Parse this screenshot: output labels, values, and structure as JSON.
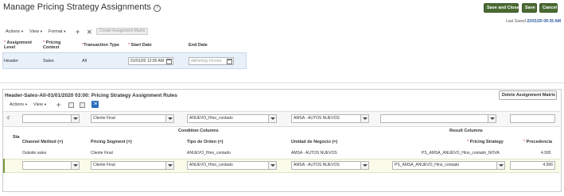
{
  "header": {
    "title": "Manage Pricing Strategy Assignments",
    "save_and_close": "Save and Close",
    "save": "Save",
    "cancel": "Cancel",
    "last_saved_label": "Last Saved",
    "last_saved_value": "22/01/20 09:35 AM"
  },
  "toolbar": {
    "actions": "Actions",
    "view": "View",
    "format": "Format",
    "create_matrix": "Create Assignment Matrix"
  },
  "top_table": {
    "headers": {
      "assignment_level": "Assignment Level",
      "pricing_context": "Pricing Context",
      "transaction_type": "Transaction Type",
      "start_date": "Start Date",
      "end_date": "End Date"
    },
    "row": {
      "assignment_level": "Header",
      "pricing_context": "Sales",
      "transaction_type": "All",
      "start_date": "01/01/20 12:00 AM",
      "end_date_placeholder": "dd/mm/yy hh:mm"
    }
  },
  "rules": {
    "title": "Header-Sales-All-01/01/2020 03:00: Pricing Strategy Assignment Rules",
    "delete_matrix": "Delete Assignment Matrix",
    "actions": "Actions",
    "view": "View",
    "filter": {
      "pricing_segment": "Cliente Final",
      "tipo_orden": "ANUEVO_Hino_contado",
      "unidad_negocio": "AMSA - AUTOS NUEVOS"
    },
    "status_col": "Sta",
    "condition_columns": "Condition Columns",
    "result_columns": "Result Columns",
    "columns": {
      "channel_method": "Channel Method (=)",
      "pricing_segment": "Pricing Segment (=)",
      "tipo_orden": "Tipo de Orden (=)",
      "unidad_negocio": "Unidad de Negocio (=)",
      "pricing_strategy": "Pricing Strategy",
      "precedencia": "Precedencia"
    },
    "rows": [
      {
        "channel_method": "Outside sales",
        "pricing_segment": "Cliente Final",
        "tipo_orden": "ANUEVO_Hino_contado",
        "unidad_negocio": "AMSA - AUTOS NUEVOS",
        "pricing_strategy": "PS_AMSA_ANUEVO_Hino_contado_NOVA",
        "precedencia": "4.995"
      }
    ],
    "edit_row": {
      "pricing_segment": "Cliente Final",
      "tipo_orden": "ANUEVO_Hino_contado",
      "unidad_negocio": "AMSA - AUTOS NUEVOS",
      "pricing_strategy": "PS_AMSA_ANUEVO_Hino_contado",
      "precedencia": "4.996"
    }
  },
  "icons": {
    "help": "help-icon",
    "add": "plus-icon",
    "delete": "x-icon",
    "calendar": "calendar-icon",
    "dropdown": "chevron-down-icon",
    "freeze": "freeze-icon",
    "detach": "detach-icon",
    "export": "export-icon"
  },
  "colors": {
    "primary_button": "#4a6b33",
    "selected_row": "#e8f0fa",
    "edit_row": "#fafbe9",
    "link_blue": "#2a5a9a"
  }
}
